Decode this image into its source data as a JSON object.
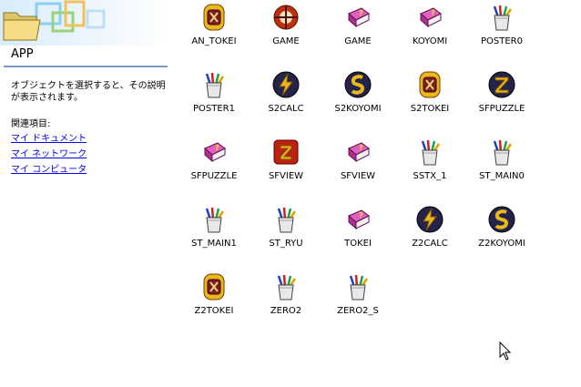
{
  "folder": {
    "title": "APP",
    "description": "オブジェクトを選択すると、その説明が表示されます。",
    "see_also": "関連項目:",
    "links": [
      "マイ ドキュメント",
      "マイ ネットワーク",
      "マイ コンピュータ"
    ]
  },
  "items": [
    {
      "label": "AN_TOKEI",
      "icon": "clock-app-icon"
    },
    {
      "label": "GAME",
      "icon": "game-app-icon"
    },
    {
      "label": "GAME",
      "icon": "help-book-icon"
    },
    {
      "label": "KOYOMI",
      "icon": "help-book-icon"
    },
    {
      "label": "POSTER0",
      "icon": "pencil-cup-icon"
    },
    {
      "label": "POSTER1",
      "icon": "pencil-cup-icon"
    },
    {
      "label": "S2CALC",
      "icon": "calculator-app-icon"
    },
    {
      "label": "S2KOYOMI",
      "icon": "calendar-app-icon"
    },
    {
      "label": "S2TOKEI",
      "icon": "clock-app-icon"
    },
    {
      "label": "SFPUZZLE",
      "icon": "puzzle-app-icon"
    },
    {
      "label": "SFPUZZLE",
      "icon": "help-book-icon"
    },
    {
      "label": "SFVIEW",
      "icon": "viewer-app-icon"
    },
    {
      "label": "SFVIEW",
      "icon": "help-book-icon"
    },
    {
      "label": "SSTX_1",
      "icon": "pencil-cup-icon"
    },
    {
      "label": "ST_MAIN0",
      "icon": "pencil-cup-icon"
    },
    {
      "label": "ST_MAIN1",
      "icon": "pencil-cup-icon"
    },
    {
      "label": "ST_RYU",
      "icon": "pencil-cup-icon"
    },
    {
      "label": "TOKEI",
      "icon": "help-book-icon"
    },
    {
      "label": "Z2CALC",
      "icon": "calculator-app-icon"
    },
    {
      "label": "Z2KOYOMI",
      "icon": "calendar-app-icon"
    },
    {
      "label": "Z2TOKEI",
      "icon": "clock-app-icon"
    },
    {
      "label": "ZERO2",
      "icon": "pencil-cup-icon"
    },
    {
      "label": "ZERO2_S",
      "icon": "pencil-cup-icon"
    }
  ],
  "colors": {
    "link": "#0000ee",
    "rule": "#7a98c8",
    "book": "#b03090",
    "app_dark": "#24244a",
    "app_gold": "#e8b81c"
  }
}
